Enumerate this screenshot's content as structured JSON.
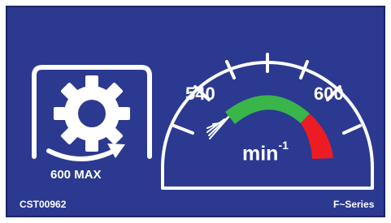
{
  "colors": {
    "panel_background": "#2b3990",
    "foreground": "#ffffff",
    "green_zone": "#39b54a",
    "red_zone": "#ed1c24"
  },
  "pto_icon": {
    "icon": "pto-gear-rotation-icon",
    "max_label": "600 MAX"
  },
  "gauge": {
    "scale_low_label": "540",
    "scale_high_label": "600",
    "unit_base": "min",
    "unit_exponent": "-1",
    "green_zone_label": "540–600",
    "red_zone_label": "above 600"
  },
  "footer": {
    "code": "CST00962",
    "series": "F~Series"
  }
}
